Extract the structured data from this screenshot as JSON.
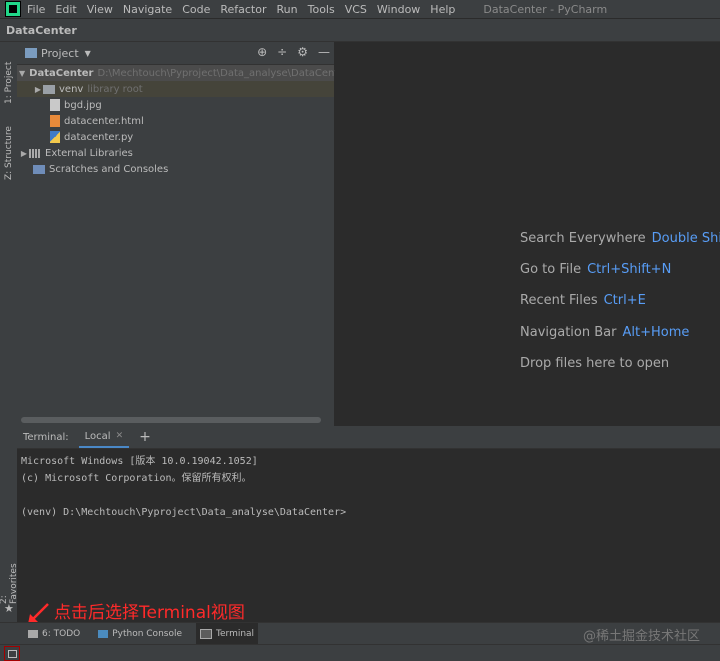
{
  "menubar": {
    "items": [
      "File",
      "Edit",
      "View",
      "Navigate",
      "Code",
      "Refactor",
      "Run",
      "Tools",
      "VCS",
      "Window",
      "Help"
    ],
    "mnemonics": [
      "F",
      "E",
      "V",
      "N",
      "C",
      "R",
      "R",
      "T",
      "S",
      "W",
      "H"
    ],
    "window_title": "DataCenter - PyCharm"
  },
  "navbar": {
    "crumb": "DataCenter"
  },
  "left_strip": {
    "project_tab": "1: Project",
    "structure_tab": "Z: Structure",
    "favorites_tab": "2: Favorites"
  },
  "project_panel": {
    "title": "Project",
    "tree": [
      {
        "name": "DataCenter",
        "note": "D:\\Mechtouch\\Pyproject\\Data_analyse\\DataCenter"
      },
      {
        "name": "venv",
        "note": "library root"
      },
      {
        "name": "bgd.jpg",
        "note": ""
      },
      {
        "name": "datacenter.html",
        "note": ""
      },
      {
        "name": "datacenter.py",
        "note": ""
      },
      {
        "name": "External Libraries",
        "note": ""
      },
      {
        "name": "Scratches and Consoles",
        "note": ""
      }
    ]
  },
  "editor": {
    "hints": [
      {
        "text": "Search Everywhere",
        "key": "Double Shift"
      },
      {
        "text": "Go to File",
        "key": "Ctrl+Shift+N"
      },
      {
        "text": "Recent Files",
        "key": "Ctrl+E"
      },
      {
        "text": "Navigation Bar",
        "key": "Alt+Home"
      },
      {
        "text": "Drop files here to open",
        "key": ""
      }
    ]
  },
  "terminal": {
    "label": "Terminal:",
    "tab": "Local",
    "lines": [
      "Microsoft Windows [版本 10.0.19042.1052]",
      "(c) Microsoft Corporation。保留所有权利。",
      "",
      "(venv) D:\\Mechtouch\\Pyproject\\Data_analyse\\DataCenter>"
    ]
  },
  "annotation": {
    "text": "点击后选择Terminal视图",
    "color": "#ff2a2a"
  },
  "bottom_tabs": [
    "6: TODO",
    "Python Console",
    "Terminal"
  ],
  "watermark": "@稀土掘金技术社区",
  "colors": {
    "accent": "#589df6",
    "chrome": "#3c3f41",
    "editor_bg": "#2b2b2b",
    "logo": "#21d789"
  }
}
